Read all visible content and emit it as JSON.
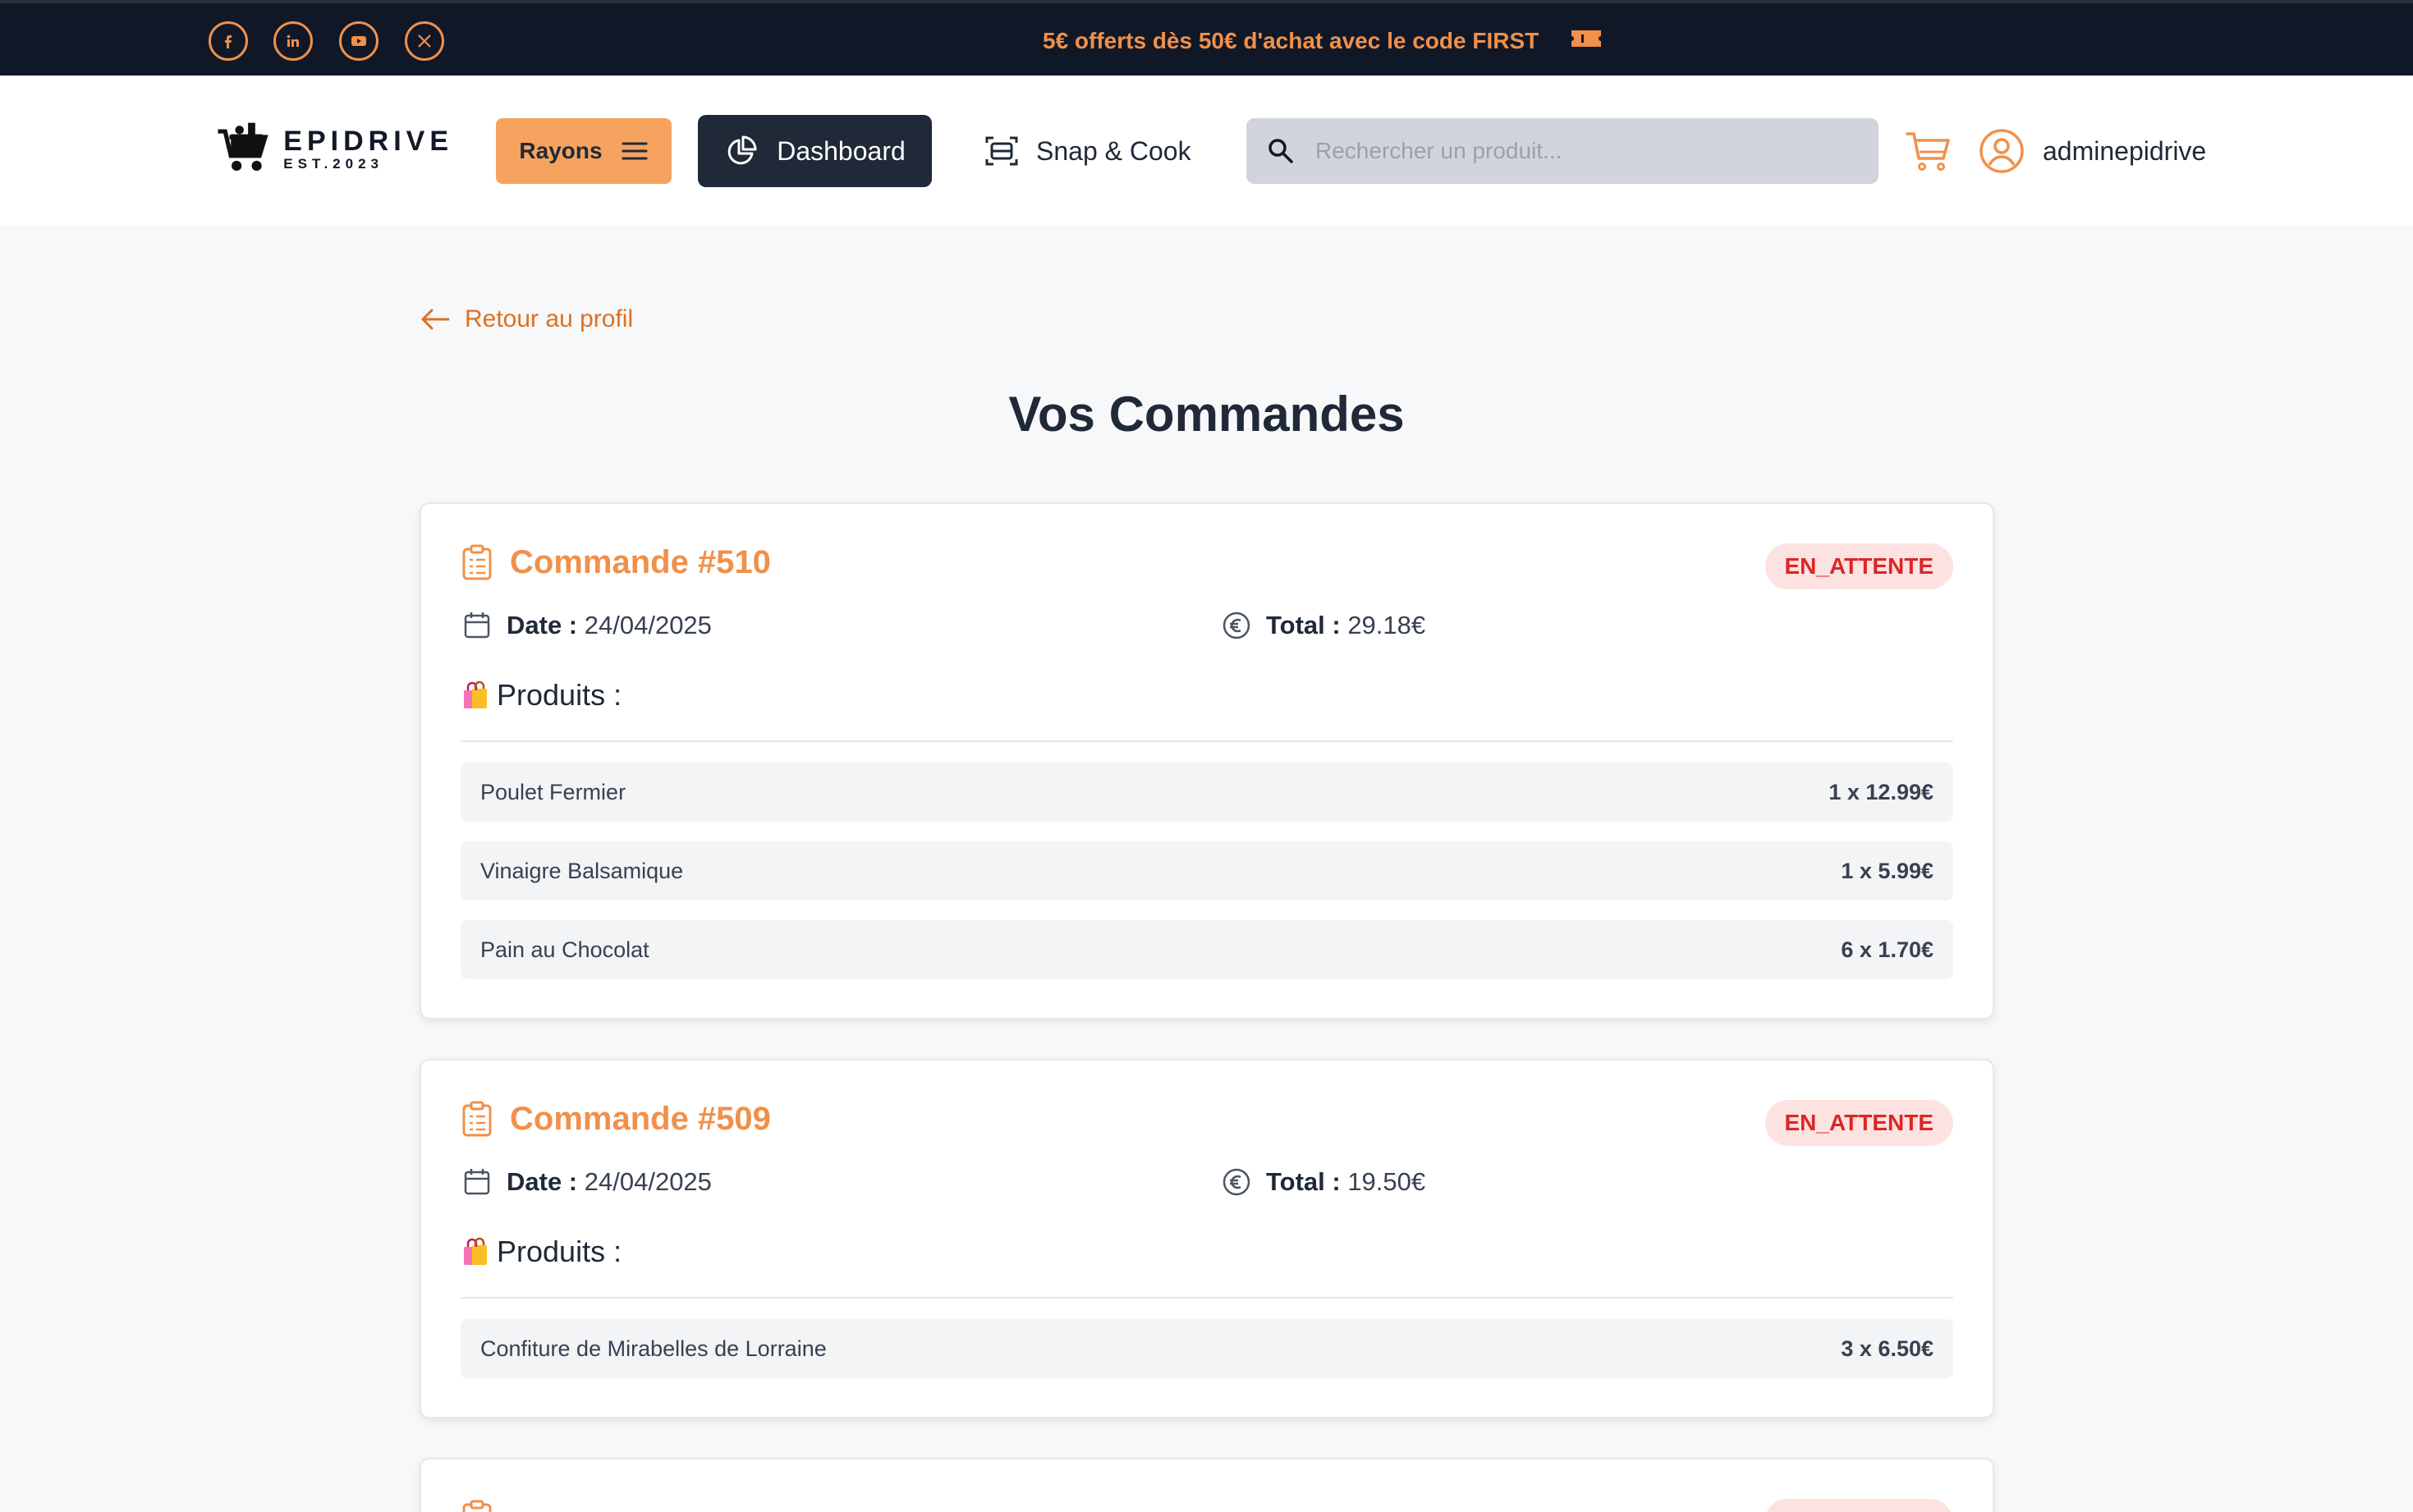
{
  "topbar": {
    "social": [
      "facebook-icon",
      "linkedin-icon",
      "youtube-icon",
      "x-icon"
    ],
    "promo_text": "5€ offerts dès 50€ d'achat avec le code FIRST",
    "promo_icon": "ticket-icon"
  },
  "header": {
    "logo": {
      "name": "EPIDRIVE",
      "est": "EST.2023"
    },
    "rayons_label": "Rayons",
    "dashboard_label": "Dashboard",
    "snap_label": "Snap & Cook",
    "search_placeholder": "Rechercher un produit...",
    "username": "adminepidrive"
  },
  "main": {
    "back_label": "Retour au profil",
    "title": "Vos Commandes",
    "date_label": "Date :",
    "total_label": "Total :",
    "products_label": "Produits :",
    "orders": [
      {
        "title": "Commande #510",
        "status": "EN_ATTENTE",
        "date": "24/04/2025",
        "total": "29.18€",
        "items": [
          {
            "name": "Poulet Fermier",
            "qty": "1 x 12.99€"
          },
          {
            "name": "Vinaigre Balsamique",
            "qty": "1 x 5.99€"
          },
          {
            "name": "Pain au Chocolat",
            "qty": "6 x 1.70€"
          }
        ]
      },
      {
        "title": "Commande #509",
        "status": "EN_ATTENTE",
        "date": "24/04/2025",
        "total": "19.50€",
        "items": [
          {
            "name": "Confiture de Mirabelles de Lorraine",
            "qty": "3 x 6.50€"
          }
        ]
      }
    ]
  },
  "colors": {
    "accent": "#f0904a",
    "dark": "#1f2937",
    "topbar": "#101828",
    "status_bg": "#fde2e2",
    "status_text": "#dc2626"
  }
}
